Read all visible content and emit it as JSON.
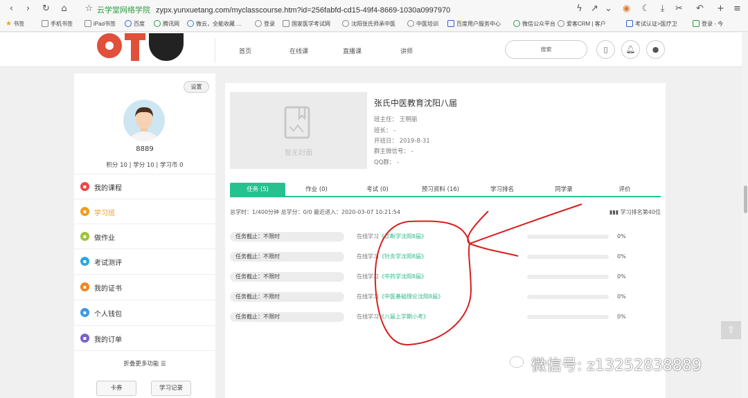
{
  "browser": {
    "url_site": "云学堂网络学院",
    "url": "zypx.yunxuetang.com/myclasscourse.htm?id=256fabfd-cd15-49f4-8669-1030a0997970",
    "bookmarks": [
      "书签",
      "手机书签",
      "iPad书签",
      "百度",
      "腾讯网",
      "微云，全能收藏 …",
      "登录",
      "国家医学考试网",
      "沈阳张氏师承中医",
      "中医培训",
      "百度用户服务中心",
      "微信公众平台",
      "爱客CRM | 客户",
      "考试认证>医疗卫",
      "登录 - 今"
    ]
  },
  "header": {
    "nav": [
      "首页",
      "在线课",
      "直播课",
      "讲师"
    ],
    "search_label": "搜索"
  },
  "sidebar": {
    "settings_label": "设置",
    "username": "8889",
    "stats": "积分 10 | 学分 10 | 学习币 0",
    "items": [
      {
        "label": "我的课程",
        "color": "#e8494b",
        "active": false
      },
      {
        "label": "学习班",
        "color": "#f29a1f",
        "active": true
      },
      {
        "label": "做作业",
        "color": "#9ac53a",
        "active": false
      },
      {
        "label": "考试测评",
        "color": "#2aa7e0",
        "active": false
      },
      {
        "label": "我的证书",
        "color": "#f2851f",
        "active": false
      },
      {
        "label": "个人钱包",
        "color": "#3a9ae0",
        "active": false
      },
      {
        "label": "我的订单",
        "color": "#7b62c9",
        "active": false
      }
    ],
    "fold_label": "折叠更多功能 ☰",
    "card_label": "卡券",
    "record_label": "学习记录"
  },
  "course": {
    "cover_text": "暂无封面",
    "title": "张氏中医教育沈阳八届",
    "teacher": "班主任： 王明丽",
    "monitor": "班长： -",
    "start_date": "开班日： 2019-8-31",
    "wechat": "群主微信号： -",
    "qq": "QQ群： -"
  },
  "tabs": [
    "任务 (5)",
    "作业 (0)",
    "考试 (0)",
    "预习资料 (16)",
    "学习排名",
    "同学录",
    "评价"
  ],
  "summary": {
    "stats": "总学时：1/400分钟   总学分：0/0   最近进入：2020-03-07 10:21:54",
    "rank": "学习排名第40位"
  },
  "tasks": [
    {
      "deadline": "任务截止：不限时",
      "prefix": "在线学习",
      "course": "《诊断学沈阳8届》",
      "progress": 0,
      "pct": "0%"
    },
    {
      "deadline": "任务截止：不限时",
      "prefix": "在线学习",
      "course": "《针灸学沈阳8届》",
      "progress": 0,
      "pct": "0%"
    },
    {
      "deadline": "任务截止：不限时",
      "prefix": "在线学习",
      "course": "《中药学沈阳8届》",
      "progress": 0,
      "pct": "0%"
    },
    {
      "deadline": "任务截止：不限时",
      "prefix": "在线学习",
      "course": "《中医基础理论沈阳8届》",
      "progress": 0,
      "pct": "0%"
    },
    {
      "deadline": "任务截止：不限时",
      "prefix": "在线学习",
      "course": "《八届上学期小考》",
      "progress": 0,
      "pct": "0%"
    }
  ],
  "watermark": "微信号: z13252838889"
}
